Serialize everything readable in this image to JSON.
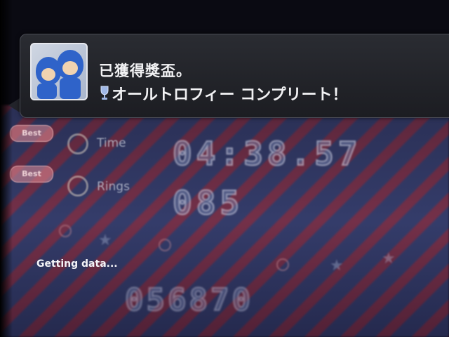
{
  "notification": {
    "title": "已獲得獎盃。",
    "trophy_name": "オールトロフィー コンプリート！",
    "icon": "trophy-icon",
    "game_icon": "sonic-game-icon"
  },
  "game_hud": {
    "best_label": "Best",
    "time_label": "Time",
    "time_value": "04:38.57",
    "rings_label": "Rings",
    "rings_value": "085",
    "score_value": "056870",
    "status_text": "Getting data..."
  }
}
